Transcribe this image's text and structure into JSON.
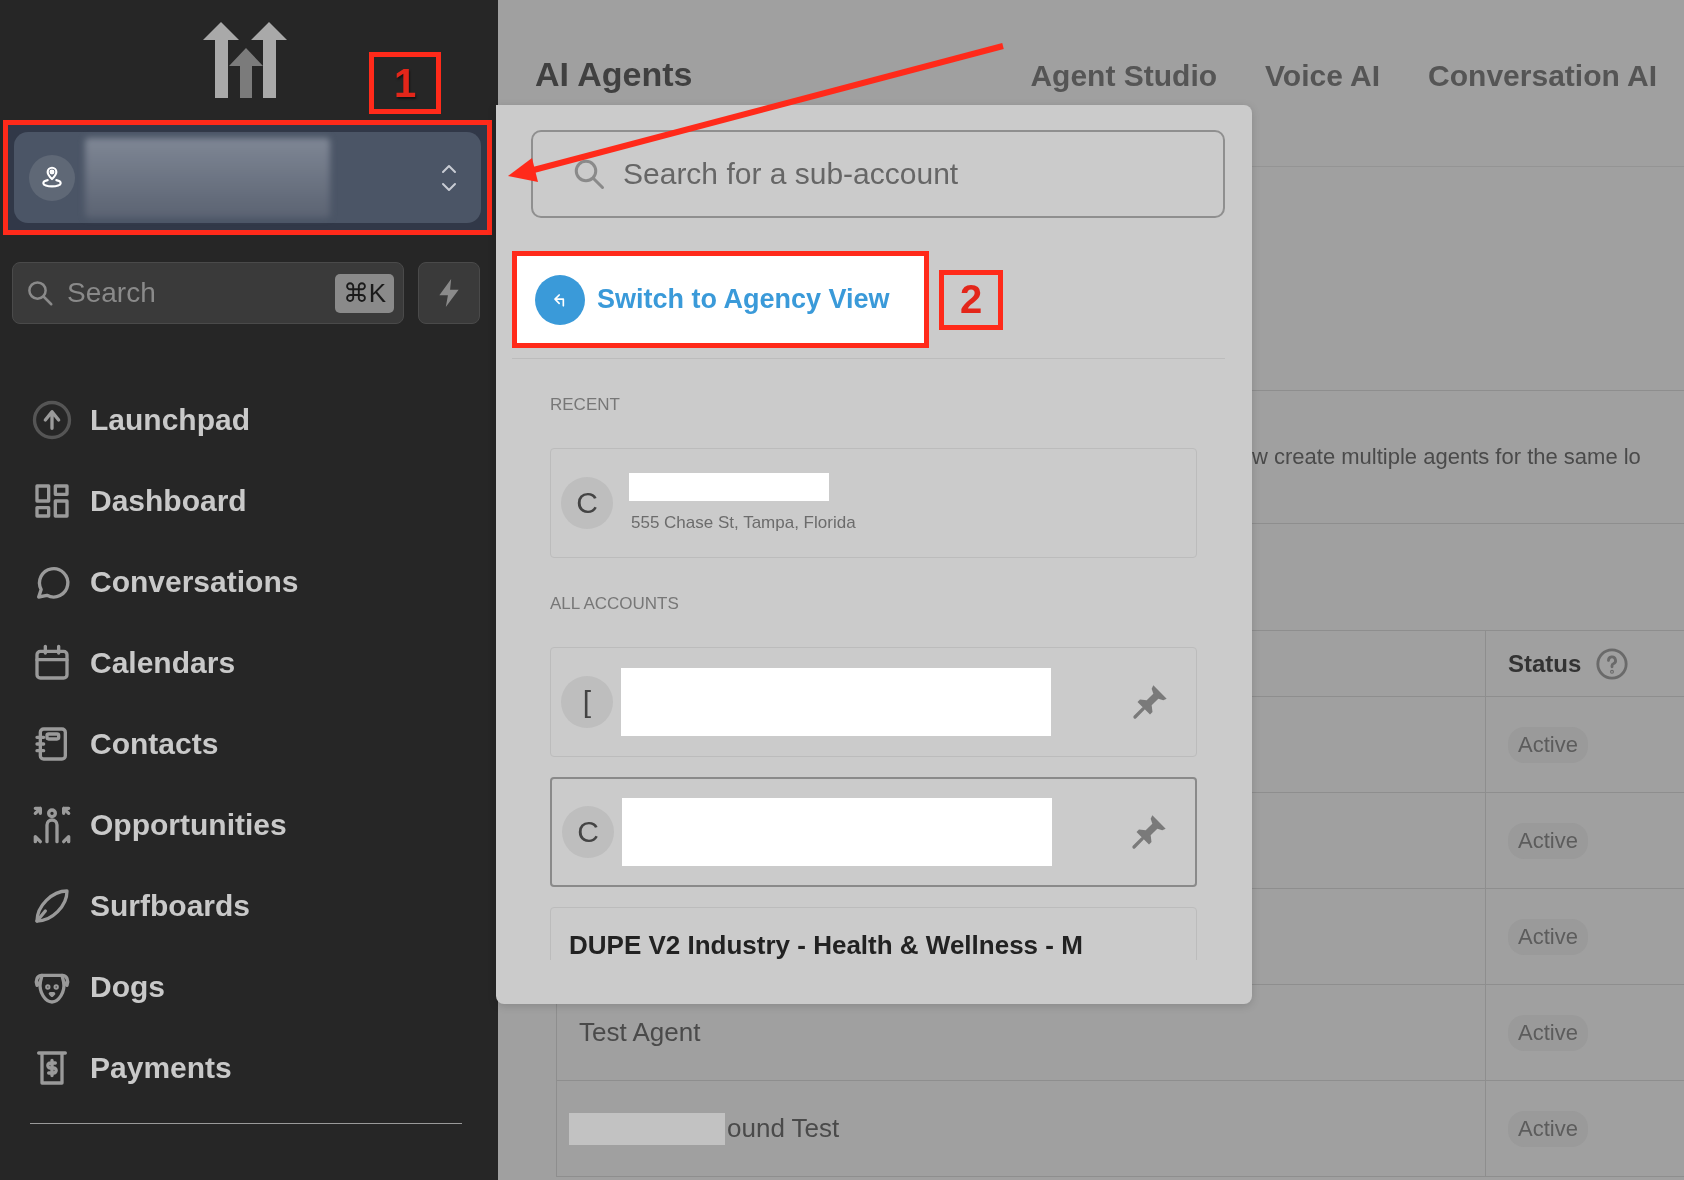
{
  "sidebar": {
    "account_switcher": {
      "annotation": "1",
      "redacted": true
    },
    "search": {
      "placeholder": "Search",
      "shortcut": "⌘K"
    },
    "nav_items": [
      {
        "label": "Launchpad"
      },
      {
        "label": "Dashboard"
      },
      {
        "label": "Conversations"
      },
      {
        "label": "Calendars"
      },
      {
        "label": "Contacts"
      },
      {
        "label": "Opportunities"
      },
      {
        "label": "Surfboards"
      },
      {
        "label": "Dogs"
      },
      {
        "label": "Payments"
      }
    ]
  },
  "header": {
    "title": "AI Agents",
    "tabs": [
      {
        "label": "Agent Studio"
      },
      {
        "label": "Voice AI"
      },
      {
        "label": "Conversation AI"
      }
    ]
  },
  "description": "w create multiple agents for the same lo",
  "table": {
    "columns": [
      {
        "label": "Status"
      }
    ],
    "rows": [
      {
        "status": "Active"
      },
      {
        "status": "Active"
      },
      {
        "status": "Active"
      },
      {
        "name": "Test Agent",
        "redacted": false,
        "status": "Active"
      },
      {
        "name": "ound Test",
        "redacted": true,
        "status": "Active"
      }
    ]
  },
  "dropdown": {
    "search": {
      "placeholder": "Search for a sub-account"
    },
    "agency_link": {
      "label": "Switch to Agency View",
      "annotation": "2"
    },
    "recent_label": "RECENT",
    "recent": [
      {
        "initial": "C",
        "redacted": true,
        "address": "555 Chase St, Tampa, Florida",
        "highlighted": false
      }
    ],
    "all_label": "ALL ACCOUNTS",
    "accounts": [
      {
        "initial": "[",
        "redacted": true,
        "highlighted": false,
        "kind": "pinned"
      },
      {
        "initial": "C",
        "redacted": true,
        "highlighted": true,
        "kind": "pinned"
      },
      {
        "name": "DUPE V2 Industry - Health & Wellness - M",
        "redacted": false,
        "highlighted": false,
        "kind": "plain"
      }
    ]
  }
}
